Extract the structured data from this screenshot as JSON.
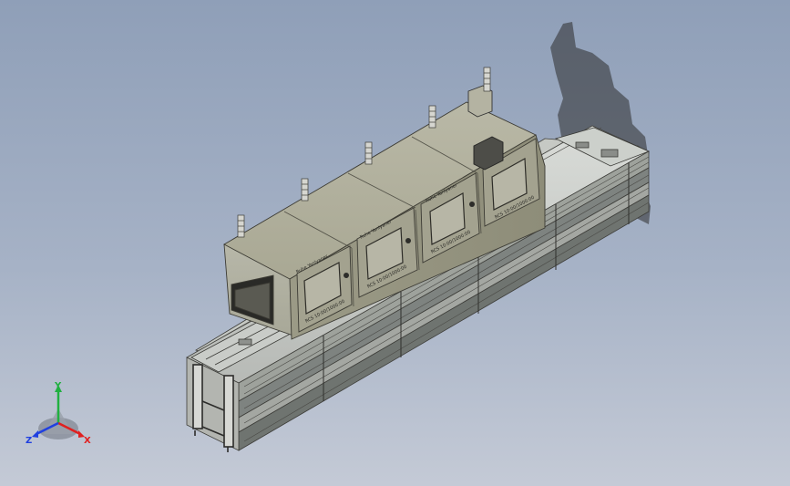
{
  "model": {
    "name_plate": "Ruhe Yanlyaner",
    "side_plate": "RCS 10:00/1000:00"
  },
  "triad": {
    "y_label": "Y",
    "x_label": "X",
    "z_label": "Z",
    "colors": {
      "x": "#e02020",
      "y": "#20b040",
      "z": "#2040e0"
    }
  }
}
